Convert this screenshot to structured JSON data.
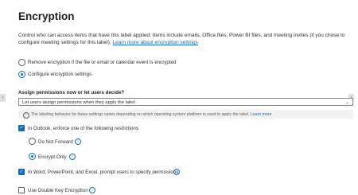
{
  "header": {
    "title": "Encryption"
  },
  "description": {
    "text": "Control who can access items that have this label applied. Items include emails, Office files, Power BI files, and meeting invites (if you chose to configure meeting settings for this label). ",
    "link": "Learn more about encryption settings"
  },
  "options": {
    "remove_label": "Remove encryption if the file or email or calendar event is encrypted",
    "configure_label": "Configure encryption settings"
  },
  "assign": {
    "label": "Assign permissions now or let users decide?",
    "selected": "Let users assign permissions when they apply the label"
  },
  "infobar": {
    "text": "The labeling behavior for these settings varies depending on which operating system platform is used to apply the label. ",
    "link": "Learn more"
  },
  "outlook": {
    "label": "In Outlook, enforce one of the following restrictions",
    "do_not_forward": "Do Not Forward",
    "encrypt_only": "Encrypt-Only"
  },
  "office_prompt": {
    "label": "In Word, PowerPoint, and Excel, prompt users to specify permissions"
  },
  "dke": {
    "label": "Use Double Key Encryption"
  },
  "icons": {
    "info": "i",
    "check": "✓",
    "chevron": "⌄",
    "scroll_left": "‹",
    "scroll_right": "›"
  }
}
